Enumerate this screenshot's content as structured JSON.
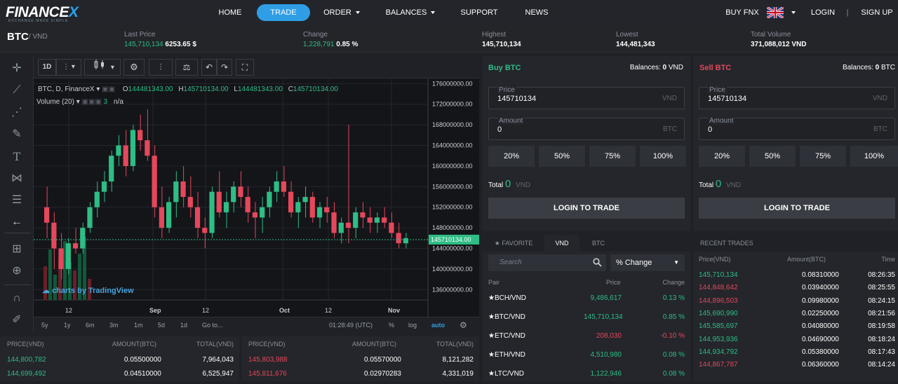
{
  "nav": {
    "brand_main": "FINANCE",
    "brand_x": "X",
    "brand_sub": "EXCHANGE MADE SIMPLE",
    "items": [
      "HOME",
      "TRADE",
      "ORDER",
      "BALANCES",
      "SUPPORT",
      "NEWS"
    ],
    "buy_fnx": "BUY FNX",
    "login": "LOGIN",
    "sep": "|",
    "signup": "SIGN UP"
  },
  "ticker": {
    "pair": "BTC",
    "quote": "/ VND",
    "last_price_label": "Last Price",
    "last_price_vnd": "145,710,134",
    "last_price_usd": "6253.65 $",
    "change_label": "Change",
    "change_value": "1,228,791",
    "change_pct": "0.85 %",
    "highest_label": "Highest",
    "highest_value": "145,710,134",
    "lowest_label": "Lowest",
    "lowest_value": "144,481,343",
    "volume_label": "Total Volume",
    "volume_value": "371,088,012 VND"
  },
  "chart": {
    "toolbar": {
      "interval": "1D",
      "menu": "⋮"
    },
    "legend": {
      "symbol": "BTC, D, FinanceX",
      "o_label": "O",
      "o": "144481343.00",
      "h_label": "H",
      "h": "145710134.00",
      "l_label": "L",
      "l": "144481343.00",
      "c_label": "C",
      "c": "145710134.00"
    },
    "volume_label": "Volume (20)",
    "volume_val": "3",
    "volume_na": "n/a",
    "watermark": "charts by TradingView",
    "price_axis": [
      "176000000.00",
      "172000000.00",
      "168000000.00",
      "164000000.00",
      "160000000.00",
      "156000000.00",
      "152000000.00",
      "148000000.00",
      "144000000.00",
      "140000000.00",
      "136000000.00"
    ],
    "current_price_tag": "145710134.00",
    "time_axis": [
      "12",
      "Sep",
      "12",
      "Oct",
      "12",
      "Nov"
    ],
    "ranges": [
      "5y",
      "1y",
      "6m",
      "3m",
      "1m",
      "5d",
      "1d",
      "Go to..."
    ],
    "clock": "01:28:49 (UTC)",
    "pct": "%",
    "log": "log",
    "auto": "auto"
  },
  "chart_data": {
    "type": "candlestick",
    "title": "",
    "ylabel": "",
    "ylim": [
      134000000,
      177000000
    ],
    "candles": [
      [
        152,
        156,
        146,
        149
      ],
      [
        149,
        151,
        140,
        144
      ],
      [
        144,
        147,
        138,
        140
      ],
      [
        140,
        146,
        139,
        145
      ],
      [
        145,
        148,
        143,
        144
      ],
      [
        144,
        149,
        143,
        148
      ],
      [
        148,
        153,
        147,
        152
      ],
      [
        152,
        157,
        150,
        155
      ],
      [
        155,
        159,
        153,
        157
      ],
      [
        157,
        163,
        155,
        162
      ],
      [
        162,
        166,
        160,
        164
      ],
      [
        164,
        167,
        158,
        160
      ],
      [
        160,
        168,
        159,
        167
      ],
      [
        167,
        170,
        163,
        165
      ],
      [
        165,
        171,
        161,
        162
      ],
      [
        162,
        164,
        150,
        152
      ],
      [
        152,
        156,
        146,
        148
      ],
      [
        148,
        154,
        147,
        153
      ],
      [
        153,
        159,
        150,
        157
      ],
      [
        157,
        160,
        152,
        154
      ],
      [
        154,
        158,
        150,
        152
      ],
      [
        152,
        155,
        146,
        148
      ],
      [
        148,
        150,
        144,
        147
      ],
      [
        147,
        156,
        146,
        155
      ],
      [
        155,
        159,
        150,
        151
      ],
      [
        151,
        155,
        148,
        153
      ],
      [
        153,
        157,
        151,
        156
      ],
      [
        156,
        159,
        152,
        154
      ],
      [
        154,
        156,
        149,
        151
      ],
      [
        151,
        153,
        146,
        150
      ],
      [
        150,
        154,
        147,
        152
      ],
      [
        152,
        156,
        150,
        155
      ],
      [
        155,
        159,
        153,
        157
      ],
      [
        157,
        160,
        154,
        155
      ],
      [
        155,
        157,
        150,
        151
      ],
      [
        151,
        154,
        148,
        153
      ],
      [
        153,
        156,
        150,
        154
      ],
      [
        154,
        155,
        149,
        150
      ],
      [
        150,
        153,
        148,
        152
      ],
      [
        152,
        154,
        149,
        151
      ],
      [
        151,
        153,
        146,
        147
      ],
      [
        147,
        150,
        145,
        149
      ],
      [
        149,
        168,
        145,
        148
      ],
      [
        148,
        152,
        146,
        151
      ],
      [
        151,
        153,
        148,
        150
      ],
      [
        150,
        152,
        147,
        149
      ],
      [
        149,
        151,
        147,
        150
      ],
      [
        150,
        152,
        148,
        149
      ],
      [
        149,
        151,
        146,
        147
      ],
      [
        147,
        149,
        144,
        145
      ],
      [
        145,
        147,
        144,
        146
      ]
    ]
  },
  "buy": {
    "title": "Buy BTC",
    "balances_label": "Balances:",
    "balances_value": "0",
    "balances_unit": "VND",
    "price_label": "Price",
    "price": "145710134",
    "price_unit": "VND",
    "amount_label": "Amount",
    "amount": "0",
    "amount_unit": "BTC",
    "pcts": [
      "20%",
      "50%",
      "75%",
      "100%"
    ],
    "total_label": "Total",
    "total": "0",
    "total_unit": "VND",
    "login": "LOGIN TO TRADE"
  },
  "sell": {
    "title": "Sell BTC",
    "balances_label": "Balances:",
    "balances_value": "0",
    "balances_unit": "BTC",
    "price_label": "Price",
    "price": "145710134",
    "price_unit": "VND",
    "amount_label": "Amount",
    "amount": "0",
    "amount_unit": "BTC",
    "pcts": [
      "20%",
      "50%",
      "75%",
      "100%"
    ],
    "total_label": "Total",
    "total": "0",
    "total_unit": "VND",
    "login": "LOGIN TO TRADE"
  },
  "markets": {
    "tabs": [
      "FAVORITE",
      "VND",
      "BTC"
    ],
    "search_placeholder": "Search",
    "sort": "% Change",
    "headers": [
      "Pair",
      "Price",
      "Change"
    ],
    "rows": [
      {
        "pair": "BCH/VND",
        "price": "9,486,617",
        "change": "0.13 %",
        "dir": "up"
      },
      {
        "pair": "BTC/VND",
        "price": "145,710,134",
        "change": "0.85 %",
        "dir": "up"
      },
      {
        "pair": "ETC/VND",
        "price": "208,030",
        "change": "-0.10 %",
        "dir": "down"
      },
      {
        "pair": "ETH/VND",
        "price": "4,510,980",
        "change": "0.08 %",
        "dir": "up"
      },
      {
        "pair": "LTC/VND",
        "price": "1,122,946",
        "change": "0.08 %",
        "dir": "up"
      }
    ]
  },
  "recent": {
    "title": "RECENT TRADES",
    "headers": [
      "Price(VND)",
      "Amount(BTC)",
      "Time"
    ],
    "rows": [
      {
        "price": "145,710,134",
        "amount": "0.08310000",
        "time": "08:26:35",
        "dir": "up"
      },
      {
        "price": "144,848,642",
        "amount": "0.03940000",
        "time": "08:25:55",
        "dir": "down"
      },
      {
        "price": "144,896,503",
        "amount": "0.09980000",
        "time": "08:24:15",
        "dir": "down"
      },
      {
        "price": "145,690,990",
        "amount": "0.02250000",
        "time": "08:21:56",
        "dir": "up"
      },
      {
        "price": "145,585,697",
        "amount": "0.04080000",
        "time": "08:19:58",
        "dir": "up"
      },
      {
        "price": "144,953,936",
        "amount": "0.04690000",
        "time": "08:18:24",
        "dir": "up"
      },
      {
        "price": "144,934,792",
        "amount": "0.05380000",
        "time": "08:17:43",
        "dir": "up"
      },
      {
        "price": "144,867,787",
        "amount": "0.06360000",
        "time": "08:14:24",
        "dir": "down"
      }
    ]
  },
  "bids": {
    "headers": [
      "PRICE(VND)",
      "AMOUNT(BTC)",
      "TOTAL(VND)"
    ],
    "rows": [
      {
        "price": "144,800,782",
        "amount": "0.05500000",
        "total": "7,964,043"
      },
      {
        "price": "144,699,492",
        "amount": "0.04510000",
        "total": "6,525,947"
      }
    ]
  },
  "asks": {
    "headers": [
      "PRICE(VND)",
      "AMOUNT(BTC)",
      "TOTAL(VND)"
    ],
    "rows": [
      {
        "price": "145,803,988",
        "amount": "0.05570000",
        "total": "8,121,282"
      },
      {
        "price": "145,811,676",
        "amount": "0.02970283",
        "total": "4,331,019"
      }
    ]
  },
  "colors": {
    "up": "#2ebd85",
    "down": "#e5475b",
    "accent": "#2f9ee6"
  }
}
